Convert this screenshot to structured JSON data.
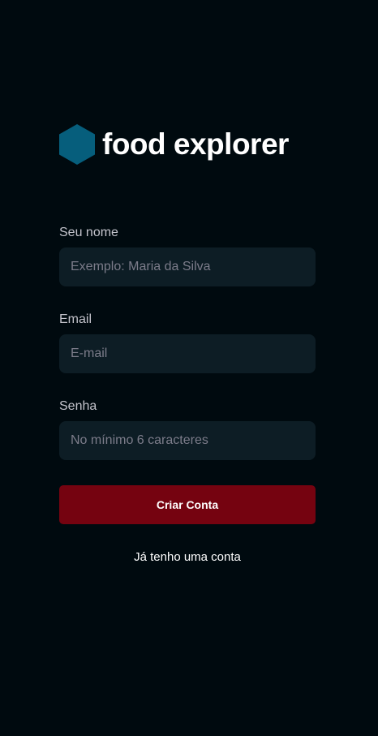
{
  "brand": {
    "icon": "hexagon-logo-icon",
    "name": "food explorer",
    "logo_color": "#065E7C"
  },
  "form": {
    "name_field": {
      "label": "Seu nome",
      "value": "",
      "placeholder": "Exemplo: Maria da Silva"
    },
    "email_field": {
      "label": "Email",
      "value": "",
      "placeholder": "E-mail"
    },
    "password_field": {
      "label": "Senha",
      "value": "",
      "placeholder": "No mínimo 6 caracteres"
    },
    "submit_label": "Criar Conta",
    "login_link": "Já tenho uma conta"
  },
  "colors": {
    "background": "#000A0F",
    "input_background": "#0D1D25",
    "primary_button": "#750310",
    "text": "#FFFFFF",
    "label": "#C4C4CC",
    "placeholder": "#7C7C8A"
  }
}
